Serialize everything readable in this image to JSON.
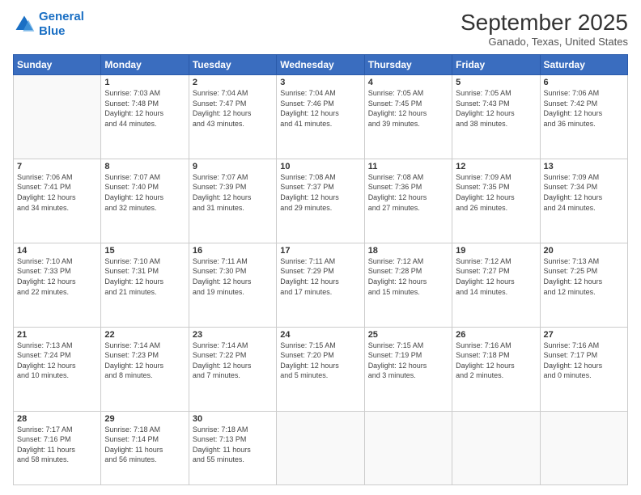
{
  "header": {
    "logo_line1": "General",
    "logo_line2": "Blue",
    "month": "September 2025",
    "location": "Ganado, Texas, United States"
  },
  "weekdays": [
    "Sunday",
    "Monday",
    "Tuesday",
    "Wednesday",
    "Thursday",
    "Friday",
    "Saturday"
  ],
  "weeks": [
    [
      {
        "day": "",
        "info": ""
      },
      {
        "day": "1",
        "info": "Sunrise: 7:03 AM\nSunset: 7:48 PM\nDaylight: 12 hours\nand 44 minutes."
      },
      {
        "day": "2",
        "info": "Sunrise: 7:04 AM\nSunset: 7:47 PM\nDaylight: 12 hours\nand 43 minutes."
      },
      {
        "day": "3",
        "info": "Sunrise: 7:04 AM\nSunset: 7:46 PM\nDaylight: 12 hours\nand 41 minutes."
      },
      {
        "day": "4",
        "info": "Sunrise: 7:05 AM\nSunset: 7:45 PM\nDaylight: 12 hours\nand 39 minutes."
      },
      {
        "day": "5",
        "info": "Sunrise: 7:05 AM\nSunset: 7:43 PM\nDaylight: 12 hours\nand 38 minutes."
      },
      {
        "day": "6",
        "info": "Sunrise: 7:06 AM\nSunset: 7:42 PM\nDaylight: 12 hours\nand 36 minutes."
      }
    ],
    [
      {
        "day": "7",
        "info": "Sunrise: 7:06 AM\nSunset: 7:41 PM\nDaylight: 12 hours\nand 34 minutes."
      },
      {
        "day": "8",
        "info": "Sunrise: 7:07 AM\nSunset: 7:40 PM\nDaylight: 12 hours\nand 32 minutes."
      },
      {
        "day": "9",
        "info": "Sunrise: 7:07 AM\nSunset: 7:39 PM\nDaylight: 12 hours\nand 31 minutes."
      },
      {
        "day": "10",
        "info": "Sunrise: 7:08 AM\nSunset: 7:37 PM\nDaylight: 12 hours\nand 29 minutes."
      },
      {
        "day": "11",
        "info": "Sunrise: 7:08 AM\nSunset: 7:36 PM\nDaylight: 12 hours\nand 27 minutes."
      },
      {
        "day": "12",
        "info": "Sunrise: 7:09 AM\nSunset: 7:35 PM\nDaylight: 12 hours\nand 26 minutes."
      },
      {
        "day": "13",
        "info": "Sunrise: 7:09 AM\nSunset: 7:34 PM\nDaylight: 12 hours\nand 24 minutes."
      }
    ],
    [
      {
        "day": "14",
        "info": "Sunrise: 7:10 AM\nSunset: 7:33 PM\nDaylight: 12 hours\nand 22 minutes."
      },
      {
        "day": "15",
        "info": "Sunrise: 7:10 AM\nSunset: 7:31 PM\nDaylight: 12 hours\nand 21 minutes."
      },
      {
        "day": "16",
        "info": "Sunrise: 7:11 AM\nSunset: 7:30 PM\nDaylight: 12 hours\nand 19 minutes."
      },
      {
        "day": "17",
        "info": "Sunrise: 7:11 AM\nSunset: 7:29 PM\nDaylight: 12 hours\nand 17 minutes."
      },
      {
        "day": "18",
        "info": "Sunrise: 7:12 AM\nSunset: 7:28 PM\nDaylight: 12 hours\nand 15 minutes."
      },
      {
        "day": "19",
        "info": "Sunrise: 7:12 AM\nSunset: 7:27 PM\nDaylight: 12 hours\nand 14 minutes."
      },
      {
        "day": "20",
        "info": "Sunrise: 7:13 AM\nSunset: 7:25 PM\nDaylight: 12 hours\nand 12 minutes."
      }
    ],
    [
      {
        "day": "21",
        "info": "Sunrise: 7:13 AM\nSunset: 7:24 PM\nDaylight: 12 hours\nand 10 minutes."
      },
      {
        "day": "22",
        "info": "Sunrise: 7:14 AM\nSunset: 7:23 PM\nDaylight: 12 hours\nand 8 minutes."
      },
      {
        "day": "23",
        "info": "Sunrise: 7:14 AM\nSunset: 7:22 PM\nDaylight: 12 hours\nand 7 minutes."
      },
      {
        "day": "24",
        "info": "Sunrise: 7:15 AM\nSunset: 7:20 PM\nDaylight: 12 hours\nand 5 minutes."
      },
      {
        "day": "25",
        "info": "Sunrise: 7:15 AM\nSunset: 7:19 PM\nDaylight: 12 hours\nand 3 minutes."
      },
      {
        "day": "26",
        "info": "Sunrise: 7:16 AM\nSunset: 7:18 PM\nDaylight: 12 hours\nand 2 minutes."
      },
      {
        "day": "27",
        "info": "Sunrise: 7:16 AM\nSunset: 7:17 PM\nDaylight: 12 hours\nand 0 minutes."
      }
    ],
    [
      {
        "day": "28",
        "info": "Sunrise: 7:17 AM\nSunset: 7:16 PM\nDaylight: 11 hours\nand 58 minutes."
      },
      {
        "day": "29",
        "info": "Sunrise: 7:18 AM\nSunset: 7:14 PM\nDaylight: 11 hours\nand 56 minutes."
      },
      {
        "day": "30",
        "info": "Sunrise: 7:18 AM\nSunset: 7:13 PM\nDaylight: 11 hours\nand 55 minutes."
      },
      {
        "day": "",
        "info": ""
      },
      {
        "day": "",
        "info": ""
      },
      {
        "day": "",
        "info": ""
      },
      {
        "day": "",
        "info": ""
      }
    ]
  ]
}
